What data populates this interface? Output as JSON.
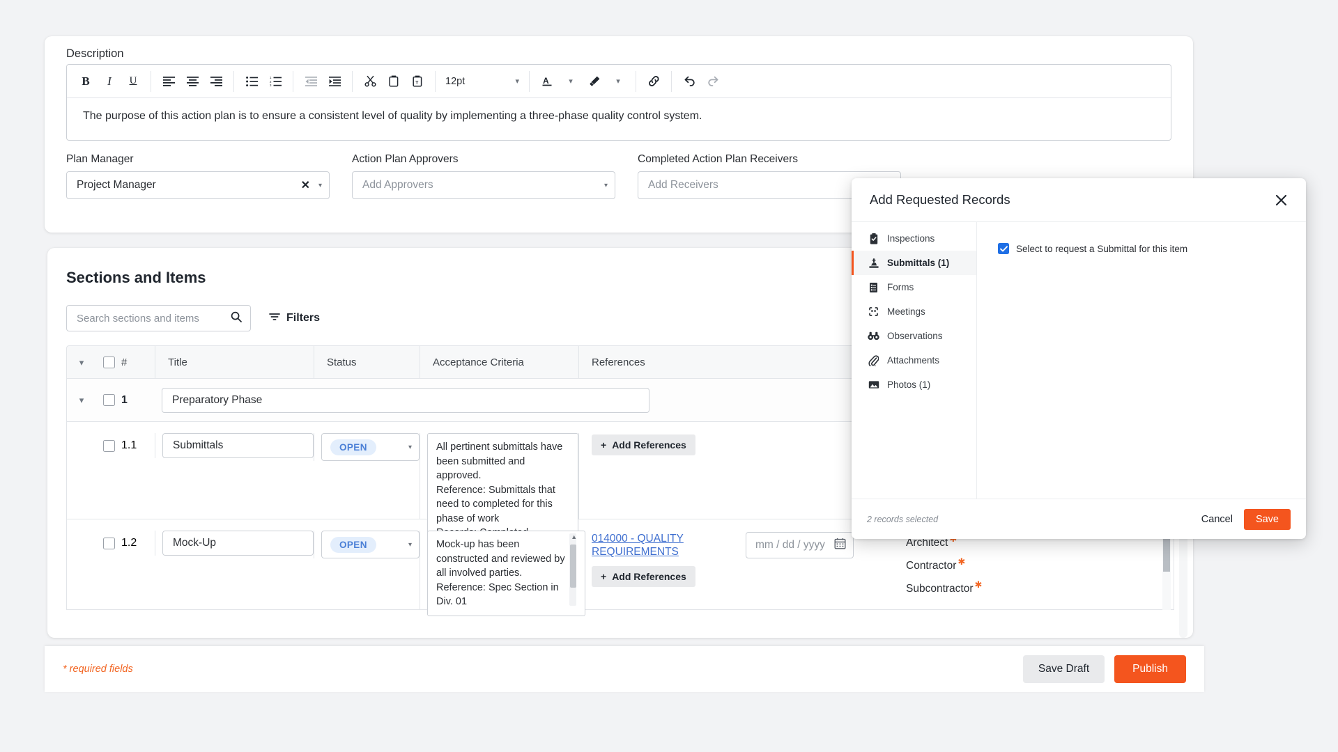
{
  "description_card": {
    "label": "Description",
    "toolbar": {
      "bold": "B",
      "italic": "I",
      "underline": "U",
      "font_size": "12pt",
      "buttons": [
        "bold",
        "italic",
        "underline",
        "align-left",
        "align-center",
        "align-right",
        "bullet-list",
        "numbered-list",
        "outdent",
        "indent",
        "cut",
        "copy",
        "paste",
        "font-size",
        "text-color",
        "highlight-color",
        "link",
        "undo",
        "redo"
      ]
    },
    "body_text": "The purpose of this action plan is to ensure a consistent level of quality by implementing a three-phase quality control system."
  },
  "form_fields": [
    {
      "label": "Plan Manager",
      "value": "Project Manager",
      "placeholder": "",
      "has_clear": true
    },
    {
      "label": "Action Plan Approvers",
      "value": "",
      "placeholder": "Add Approvers",
      "has_clear": false
    },
    {
      "label": "Completed Action Plan Receivers",
      "value": "",
      "placeholder": "Add Receivers",
      "has_clear": false
    }
  ],
  "sections_card": {
    "title": "Sections and Items",
    "search_placeholder": "Search sections and items",
    "search_value": "",
    "filters_label": "Filters",
    "columns": [
      "#",
      "Title",
      "Status",
      "Acceptance Criteria",
      "References"
    ],
    "section_row": {
      "number": "1",
      "title": "Preparatory Phase"
    },
    "items": [
      {
        "number": "1.1",
        "title": "Submittals",
        "status": "OPEN",
        "acceptance_criteria": "All pertinent submittals have been submitted and approved.\nReference: Submittals that need to completed for this phase of work\nRecords: Completed Submittals",
        "references": [],
        "add_references_label": "Add References",
        "date_placeholder": "",
        "assignees": []
      },
      {
        "number": "1.2",
        "title": "Mock-Up",
        "status": "OPEN",
        "acceptance_criteria": "Mock-up has been constructed and reviewed by all involved parties.\nReference: Spec Section in Div. 01",
        "references": [
          "014000 - QUALITY REQUIREMENTS"
        ],
        "add_references_label": "Add References",
        "date_placeholder": "mm / dd / yyyy",
        "assignees": [
          "Architect",
          "Contractor",
          "Subcontractor"
        ]
      }
    ]
  },
  "footer": {
    "required_note": "* required fields",
    "save_draft_label": "Save Draft",
    "publish_label": "Publish"
  },
  "modal": {
    "title": "Add Requested Records",
    "nav_items": [
      {
        "label": "Inspections",
        "icon": "clipboard-check-icon",
        "active": false
      },
      {
        "label": "Submittals (1)",
        "icon": "stamp-icon",
        "active": true
      },
      {
        "label": "Forms",
        "icon": "document-list-icon",
        "active": false
      },
      {
        "label": "Meetings",
        "icon": "meeting-icon",
        "active": false
      },
      {
        "label": "Observations",
        "icon": "binoculars-icon",
        "active": false
      },
      {
        "label": "Attachments",
        "icon": "paperclip-icon",
        "active": false
      },
      {
        "label": "Photos (1)",
        "icon": "photo-icon",
        "active": false
      }
    ],
    "checkbox_label": "Select to request a Submittal for this item",
    "checkbox_checked": true,
    "records_selected": "2 records selected",
    "cancel_label": "Cancel",
    "save_label": "Save"
  },
  "colors": {
    "accent_orange": "#f4551e",
    "required_orange": "#f26522",
    "link_blue": "#3f6fd0",
    "status_pill_bg": "#e3eefc",
    "status_pill_text": "#4a7fd6",
    "checkbox_blue": "#1f6fe5",
    "page_bg": "#f2f3f5"
  }
}
